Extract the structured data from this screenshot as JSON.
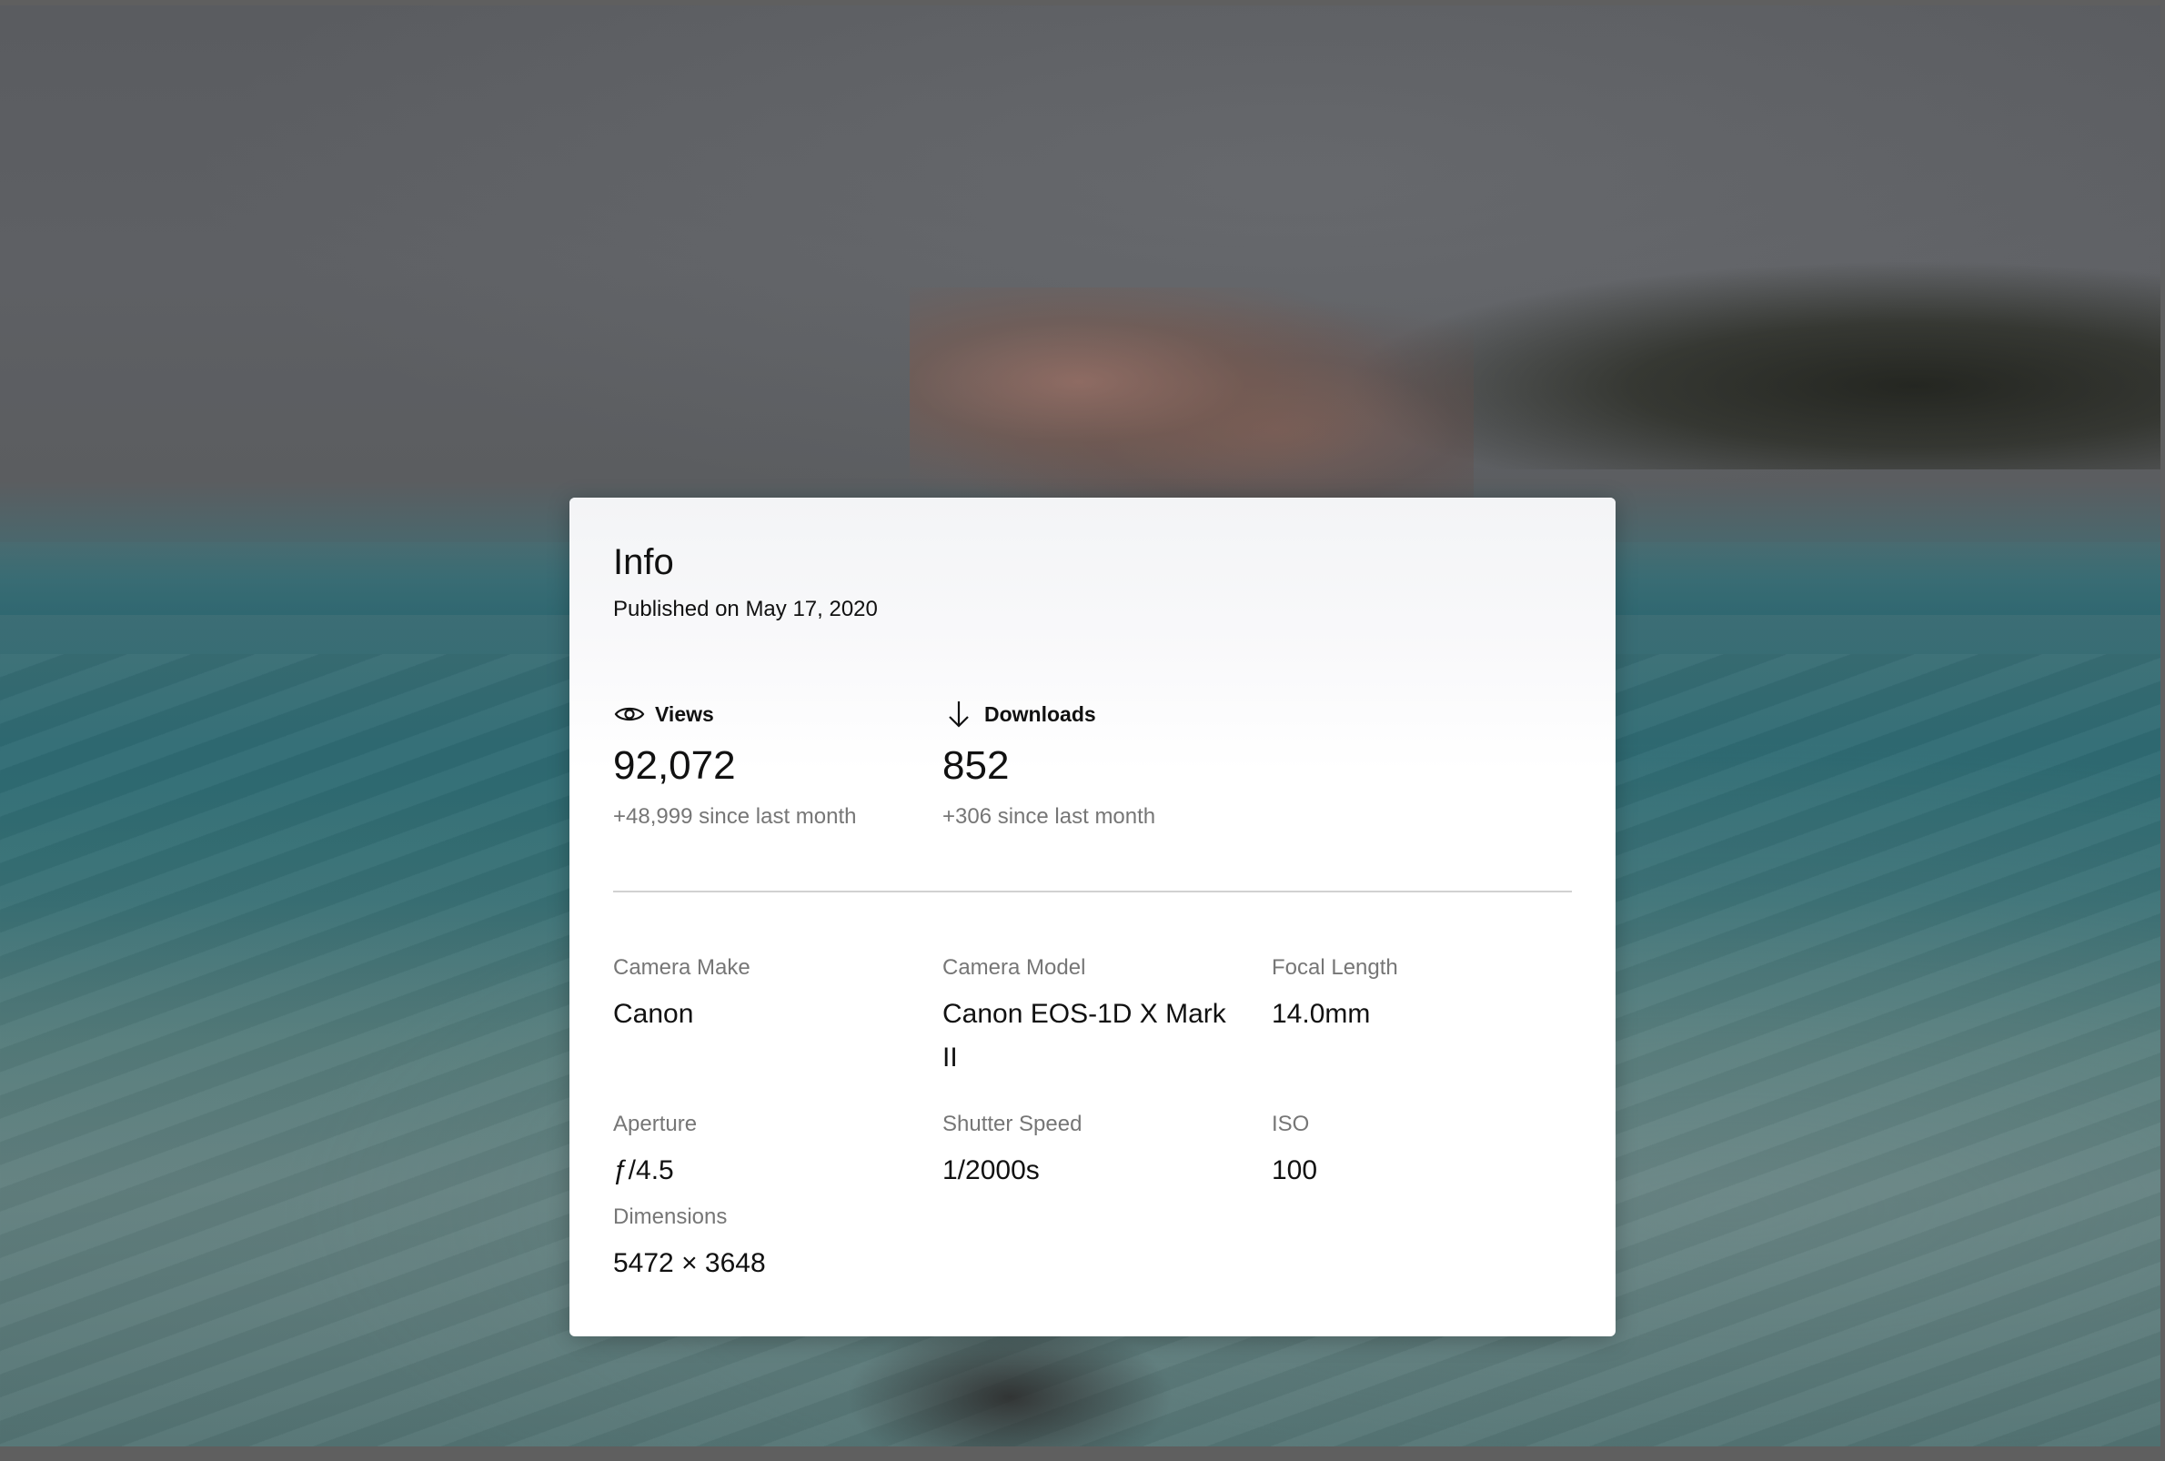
{
  "info": {
    "title": "Info",
    "published": "Published on May 17, 2020"
  },
  "stats": {
    "views": {
      "icon": "eye-icon",
      "label": "Views",
      "value": "92,072",
      "delta": "+48,999 since last month"
    },
    "downloads": {
      "icon": "arrow-down-icon",
      "label": "Downloads",
      "value": "852",
      "delta": "+306 since last month"
    }
  },
  "specs": {
    "camera_make": {
      "label": "Camera Make",
      "value": "Canon"
    },
    "camera_model": {
      "label": "Camera Model",
      "value": "Canon EOS-1D X Mark II"
    },
    "focal_length": {
      "label": "Focal Length",
      "value": "14.0mm"
    },
    "aperture": {
      "label": "Aperture",
      "value": "ƒ/4.5"
    },
    "shutter_speed": {
      "label": "Shutter Speed",
      "value": "1/2000s"
    },
    "iso": {
      "label": "ISO",
      "value": "100"
    },
    "dimensions": {
      "label": "Dimensions",
      "value": "5472 × 3648"
    }
  },
  "colors": {
    "text_primary": "#111111",
    "text_secondary": "#767676",
    "divider": "#d1d1d1",
    "card_background": "#ffffff"
  }
}
